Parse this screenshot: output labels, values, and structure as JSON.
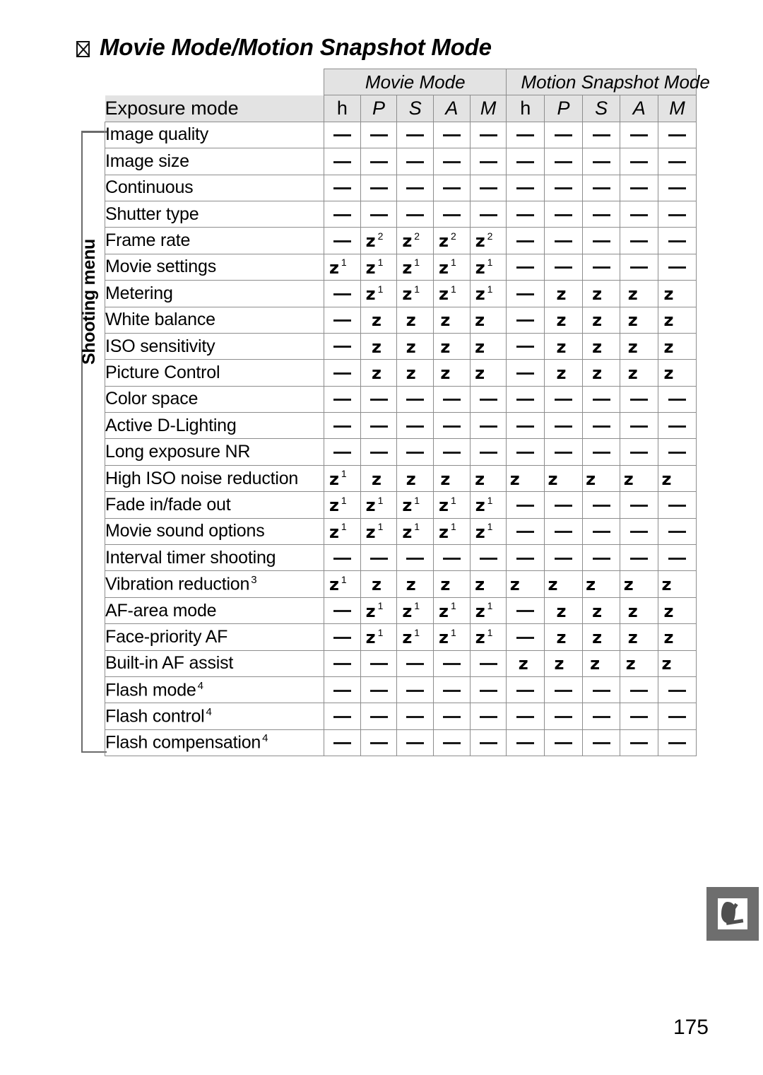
{
  "page": {
    "heading_icon": "missing-glyph-box-icon",
    "heading": "Movie Mode/Motion Snapshot Mode",
    "page_number": "175",
    "side_tab_icon": "note-pencil-icon",
    "vertical_section_label": "Shooting menu"
  },
  "table": {
    "groups": [
      {
        "label": "Movie Mode",
        "span": 5
      },
      {
        "label": "Motion Snapshot Mode",
        "span": 5
      }
    ],
    "row_header_label": "Exposure mode",
    "mode_columns": [
      "h",
      "P",
      "S",
      "A",
      "M",
      "h",
      "P",
      "S",
      "A",
      "M"
    ],
    "symbols": {
      "available": "z",
      "not_available": "—"
    },
    "rows": [
      {
        "label": "Image quality",
        "sup": "",
        "cells": [
          {
            "t": "dash"
          },
          {
            "t": "dash"
          },
          {
            "t": "dash"
          },
          {
            "t": "dash"
          },
          {
            "t": "dash"
          },
          {
            "t": "dash"
          },
          {
            "t": "dash"
          },
          {
            "t": "dash"
          },
          {
            "t": "dash"
          },
          {
            "t": "dash"
          }
        ]
      },
      {
        "label": "Image size",
        "sup": "",
        "cells": [
          {
            "t": "dash"
          },
          {
            "t": "dash"
          },
          {
            "t": "dash"
          },
          {
            "t": "dash"
          },
          {
            "t": "dash"
          },
          {
            "t": "dash"
          },
          {
            "t": "dash"
          },
          {
            "t": "dash"
          },
          {
            "t": "dash"
          },
          {
            "t": "dash"
          }
        ]
      },
      {
        "label": "Continuous",
        "sup": "",
        "cells": [
          {
            "t": "dash"
          },
          {
            "t": "dash"
          },
          {
            "t": "dash"
          },
          {
            "t": "dash"
          },
          {
            "t": "dash"
          },
          {
            "t": "dash"
          },
          {
            "t": "dash"
          },
          {
            "t": "dash"
          },
          {
            "t": "dash"
          },
          {
            "t": "dash"
          }
        ]
      },
      {
        "label": "Shutter type",
        "sup": "",
        "cells": [
          {
            "t": "dash"
          },
          {
            "t": "dash"
          },
          {
            "t": "dash"
          },
          {
            "t": "dash"
          },
          {
            "t": "dash"
          },
          {
            "t": "dash"
          },
          {
            "t": "dash"
          },
          {
            "t": "dash"
          },
          {
            "t": "dash"
          },
          {
            "t": "dash"
          }
        ]
      },
      {
        "label": "Frame rate",
        "sup": "",
        "cells": [
          {
            "t": "dash"
          },
          {
            "t": "chk",
            "n": "2"
          },
          {
            "t": "chk",
            "n": "2"
          },
          {
            "t": "chk",
            "n": "2"
          },
          {
            "t": "chk",
            "n": "2"
          },
          {
            "t": "dash"
          },
          {
            "t": "dash"
          },
          {
            "t": "dash"
          },
          {
            "t": "dash"
          },
          {
            "t": "dash"
          }
        ]
      },
      {
        "label": "Movie settings",
        "sup": "",
        "cells": [
          {
            "t": "chk",
            "n": "1"
          },
          {
            "t": "chk",
            "n": "1"
          },
          {
            "t": "chk",
            "n": "1"
          },
          {
            "t": "chk",
            "n": "1"
          },
          {
            "t": "chk",
            "n": "1"
          },
          {
            "t": "dash"
          },
          {
            "t": "dash"
          },
          {
            "t": "dash"
          },
          {
            "t": "dash"
          },
          {
            "t": "dash"
          }
        ]
      },
      {
        "label": "Metering",
        "sup": "",
        "cells": [
          {
            "t": "dash"
          },
          {
            "t": "chk",
            "n": "1"
          },
          {
            "t": "chk",
            "n": "1"
          },
          {
            "t": "chk",
            "n": "1"
          },
          {
            "t": "chk",
            "n": "1"
          },
          {
            "t": "dash"
          },
          {
            "t": "chk"
          },
          {
            "t": "chk"
          },
          {
            "t": "chk"
          },
          {
            "t": "chk"
          }
        ]
      },
      {
        "label": "White balance",
        "sup": "",
        "cells": [
          {
            "t": "dash"
          },
          {
            "t": "chk"
          },
          {
            "t": "chk"
          },
          {
            "t": "chk"
          },
          {
            "t": "chk"
          },
          {
            "t": "dash"
          },
          {
            "t": "chk"
          },
          {
            "t": "chk"
          },
          {
            "t": "chk"
          },
          {
            "t": "chk"
          }
        ]
      },
      {
        "label": "ISO sensitivity",
        "sup": "",
        "cells": [
          {
            "t": "dash"
          },
          {
            "t": "chk"
          },
          {
            "t": "chk"
          },
          {
            "t": "chk"
          },
          {
            "t": "chk"
          },
          {
            "t": "dash"
          },
          {
            "t": "chk"
          },
          {
            "t": "chk"
          },
          {
            "t": "chk"
          },
          {
            "t": "chk"
          }
        ]
      },
      {
        "label": "Picture Control",
        "sup": "",
        "cells": [
          {
            "t": "dash"
          },
          {
            "t": "chk"
          },
          {
            "t": "chk"
          },
          {
            "t": "chk"
          },
          {
            "t": "chk"
          },
          {
            "t": "dash"
          },
          {
            "t": "chk"
          },
          {
            "t": "chk"
          },
          {
            "t": "chk"
          },
          {
            "t": "chk"
          }
        ]
      },
      {
        "label": "Color space",
        "sup": "",
        "cells": [
          {
            "t": "dash"
          },
          {
            "t": "dash"
          },
          {
            "t": "dash"
          },
          {
            "t": "dash"
          },
          {
            "t": "dash"
          },
          {
            "t": "dash"
          },
          {
            "t": "dash"
          },
          {
            "t": "dash"
          },
          {
            "t": "dash"
          },
          {
            "t": "dash"
          }
        ]
      },
      {
        "label": "Active D-Lighting",
        "sup": "",
        "cells": [
          {
            "t": "dash"
          },
          {
            "t": "dash"
          },
          {
            "t": "dash"
          },
          {
            "t": "dash"
          },
          {
            "t": "dash"
          },
          {
            "t": "dash"
          },
          {
            "t": "dash"
          },
          {
            "t": "dash"
          },
          {
            "t": "dash"
          },
          {
            "t": "dash"
          }
        ]
      },
      {
        "label": "Long exposure NR",
        "sup": "",
        "cells": [
          {
            "t": "dash"
          },
          {
            "t": "dash"
          },
          {
            "t": "dash"
          },
          {
            "t": "dash"
          },
          {
            "t": "dash"
          },
          {
            "t": "dash"
          },
          {
            "t": "dash"
          },
          {
            "t": "dash"
          },
          {
            "t": "dash"
          },
          {
            "t": "dash"
          }
        ]
      },
      {
        "label": "High ISO noise reduction",
        "sup": "",
        "cells": [
          {
            "t": "chk",
            "n": "1"
          },
          {
            "t": "chk"
          },
          {
            "t": "chk"
          },
          {
            "t": "chk"
          },
          {
            "t": "chk"
          },
          {
            "t": "chk"
          },
          {
            "t": "chk"
          },
          {
            "t": "chk"
          },
          {
            "t": "chk"
          },
          {
            "t": "chk"
          }
        ]
      },
      {
        "label": "Fade in/fade out",
        "sup": "",
        "cells": [
          {
            "t": "chk",
            "n": "1"
          },
          {
            "t": "chk",
            "n": "1"
          },
          {
            "t": "chk",
            "n": "1"
          },
          {
            "t": "chk",
            "n": "1"
          },
          {
            "t": "chk",
            "n": "1"
          },
          {
            "t": "dash"
          },
          {
            "t": "dash"
          },
          {
            "t": "dash"
          },
          {
            "t": "dash"
          },
          {
            "t": "dash"
          }
        ]
      },
      {
        "label": "Movie sound options",
        "sup": "",
        "cells": [
          {
            "t": "chk",
            "n": "1"
          },
          {
            "t": "chk",
            "n": "1"
          },
          {
            "t": "chk",
            "n": "1"
          },
          {
            "t": "chk",
            "n": "1"
          },
          {
            "t": "chk",
            "n": "1"
          },
          {
            "t": "dash"
          },
          {
            "t": "dash"
          },
          {
            "t": "dash"
          },
          {
            "t": "dash"
          },
          {
            "t": "dash"
          }
        ]
      },
      {
        "label": "Interval timer shooting",
        "sup": "",
        "cells": [
          {
            "t": "dash"
          },
          {
            "t": "dash"
          },
          {
            "t": "dash"
          },
          {
            "t": "dash"
          },
          {
            "t": "dash"
          },
          {
            "t": "dash"
          },
          {
            "t": "dash"
          },
          {
            "t": "dash"
          },
          {
            "t": "dash"
          },
          {
            "t": "dash"
          }
        ]
      },
      {
        "label": "Vibration reduction",
        "sup": "3",
        "cells": [
          {
            "t": "chk",
            "n": "1"
          },
          {
            "t": "chk"
          },
          {
            "t": "chk"
          },
          {
            "t": "chk"
          },
          {
            "t": "chk"
          },
          {
            "t": "chk"
          },
          {
            "t": "chk"
          },
          {
            "t": "chk"
          },
          {
            "t": "chk"
          },
          {
            "t": "chk"
          }
        ]
      },
      {
        "label": "AF-area mode",
        "sup": "",
        "cells": [
          {
            "t": "dash"
          },
          {
            "t": "chk",
            "n": "1"
          },
          {
            "t": "chk",
            "n": "1"
          },
          {
            "t": "chk",
            "n": "1"
          },
          {
            "t": "chk",
            "n": "1"
          },
          {
            "t": "dash"
          },
          {
            "t": "chk"
          },
          {
            "t": "chk"
          },
          {
            "t": "chk"
          },
          {
            "t": "chk"
          }
        ]
      },
      {
        "label": "Face-priority AF",
        "sup": "",
        "cells": [
          {
            "t": "dash"
          },
          {
            "t": "chk",
            "n": "1"
          },
          {
            "t": "chk",
            "n": "1"
          },
          {
            "t": "chk",
            "n": "1"
          },
          {
            "t": "chk",
            "n": "1"
          },
          {
            "t": "dash"
          },
          {
            "t": "chk"
          },
          {
            "t": "chk"
          },
          {
            "t": "chk"
          },
          {
            "t": "chk"
          }
        ]
      },
      {
        "label": "Built-in AF assist",
        "sup": "",
        "cells": [
          {
            "t": "dash"
          },
          {
            "t": "dash"
          },
          {
            "t": "dash"
          },
          {
            "t": "dash"
          },
          {
            "t": "dash"
          },
          {
            "t": "chk"
          },
          {
            "t": "chk"
          },
          {
            "t": "chk"
          },
          {
            "t": "chk"
          },
          {
            "t": "chk"
          }
        ]
      },
      {
        "label": "Flash mode",
        "sup": "4",
        "cells": [
          {
            "t": "dash"
          },
          {
            "t": "dash"
          },
          {
            "t": "dash"
          },
          {
            "t": "dash"
          },
          {
            "t": "dash"
          },
          {
            "t": "dash"
          },
          {
            "t": "dash"
          },
          {
            "t": "dash"
          },
          {
            "t": "dash"
          },
          {
            "t": "dash"
          }
        ]
      },
      {
        "label": "Flash control",
        "sup": "4",
        "cells": [
          {
            "t": "dash"
          },
          {
            "t": "dash"
          },
          {
            "t": "dash"
          },
          {
            "t": "dash"
          },
          {
            "t": "dash"
          },
          {
            "t": "dash"
          },
          {
            "t": "dash"
          },
          {
            "t": "dash"
          },
          {
            "t": "dash"
          },
          {
            "t": "dash"
          }
        ]
      },
      {
        "label": "Flash compensation",
        "sup": "4",
        "cells": [
          {
            "t": "dash"
          },
          {
            "t": "dash"
          },
          {
            "t": "dash"
          },
          {
            "t": "dash"
          },
          {
            "t": "dash"
          },
          {
            "t": "dash"
          },
          {
            "t": "dash"
          },
          {
            "t": "dash"
          },
          {
            "t": "dash"
          },
          {
            "t": "dash"
          }
        ]
      }
    ]
  }
}
